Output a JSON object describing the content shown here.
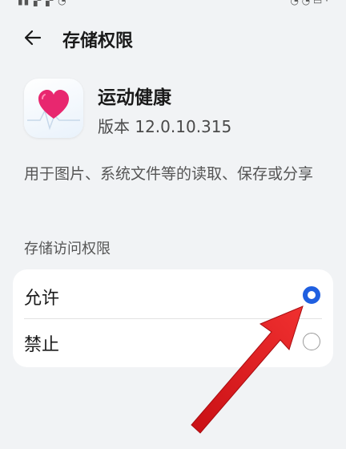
{
  "header": {
    "title": "存储权限",
    "back_icon": "arrow-left-icon"
  },
  "app": {
    "name": "运动健康",
    "version": "版本 12.0.10.315",
    "icon": "heart-icon",
    "colors": {
      "heart": "#e8276f"
    }
  },
  "description": "用于图片、系统文件等的读取、保存或分享",
  "permission": {
    "section_label": "存储访问权限",
    "options": [
      {
        "label": "允许",
        "selected": true
      },
      {
        "label": "禁止",
        "selected": false
      }
    ]
  },
  "colors": {
    "accent": "#1f5fe0",
    "annotation_arrow": "#e21b1b"
  }
}
